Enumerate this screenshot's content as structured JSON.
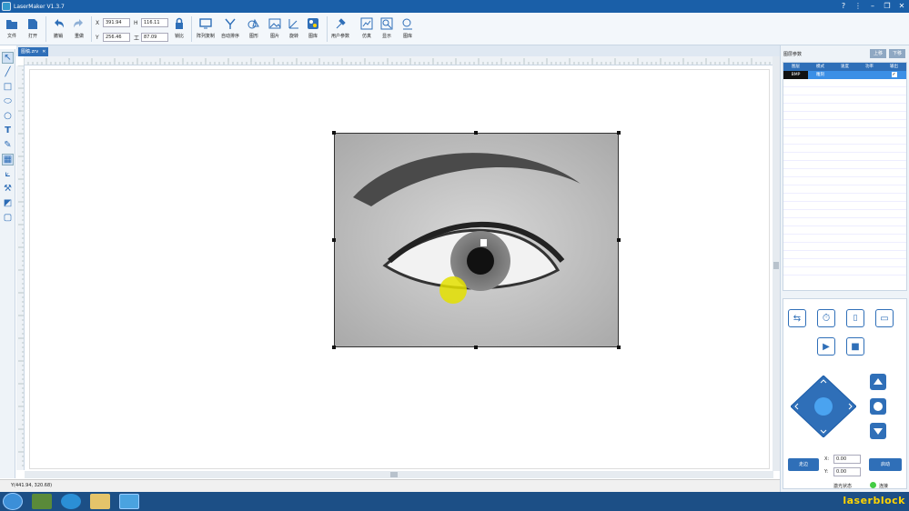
{
  "app": {
    "title": "LaserMaker V1.3.7"
  },
  "ribbon": {
    "buttons": [
      {
        "key": "file",
        "label": "文件",
        "icon": "folder-icon"
      },
      {
        "key": "open",
        "label": "打开",
        "icon": "open-file-icon"
      },
      {
        "key": "undo",
        "label": "撤销",
        "icon": "undo-icon"
      },
      {
        "key": "redo",
        "label": "重做",
        "icon": "redo-icon"
      },
      {
        "key": "lock",
        "label": "锁比",
        "icon": "lock-icon"
      },
      {
        "key": "array",
        "label": "阵列复制",
        "icon": "array-copy-icon"
      },
      {
        "key": "autosort",
        "label": "自动排序",
        "icon": "auto-sort-icon"
      },
      {
        "key": "shape",
        "label": "图形",
        "icon": "shape-icon"
      },
      {
        "key": "image",
        "label": "图片",
        "icon": "image-icon"
      },
      {
        "key": "rotate",
        "label": "旋转",
        "icon": "rotate-icon"
      },
      {
        "key": "gallery",
        "label": "图库",
        "icon": "gallery-icon"
      },
      {
        "key": "userparams",
        "label": "用户参数",
        "icon": "user-params-icon"
      },
      {
        "key": "simulate",
        "label": "仿真",
        "icon": "simulate-icon"
      },
      {
        "key": "display",
        "label": "显示",
        "icon": "display-icon"
      },
      {
        "key": "library",
        "label": "图库",
        "icon": "library-icon"
      }
    ],
    "coords": {
      "x_label": "X",
      "x": "391.94",
      "y_label": "Y",
      "y": "256.46",
      "h_label": "H",
      "h": "116.11",
      "t_label": "工",
      "t": "87.09"
    }
  },
  "document": {
    "tab_label": "图稿.zrv",
    "tab_close": "✕"
  },
  "status": {
    "text": "Y(441.94, 320.68)"
  },
  "right_panel": {
    "title": "图层参数",
    "up": "上移",
    "down": "下移",
    "table_headers": [
      "图层",
      "模式",
      "速度",
      "功率",
      "输出"
    ],
    "rows": [
      [
        "BMP",
        "雕刻",
        "",
        "",
        ""
      ]
    ]
  },
  "controls": {
    "frame_label": "走边",
    "start_label": "启动",
    "x_label": "X:",
    "x_value": "0.00",
    "y_label": "Y:",
    "y_value": "0.00",
    "laser_state_label": "激光状态",
    "connect_label": "连接"
  },
  "taskbar": {
    "brand": "laserblock"
  },
  "colors": {
    "accent": "#2f6fb8",
    "title_bar": "#1a5fa8",
    "selected_row": "#3b8fe6"
  }
}
